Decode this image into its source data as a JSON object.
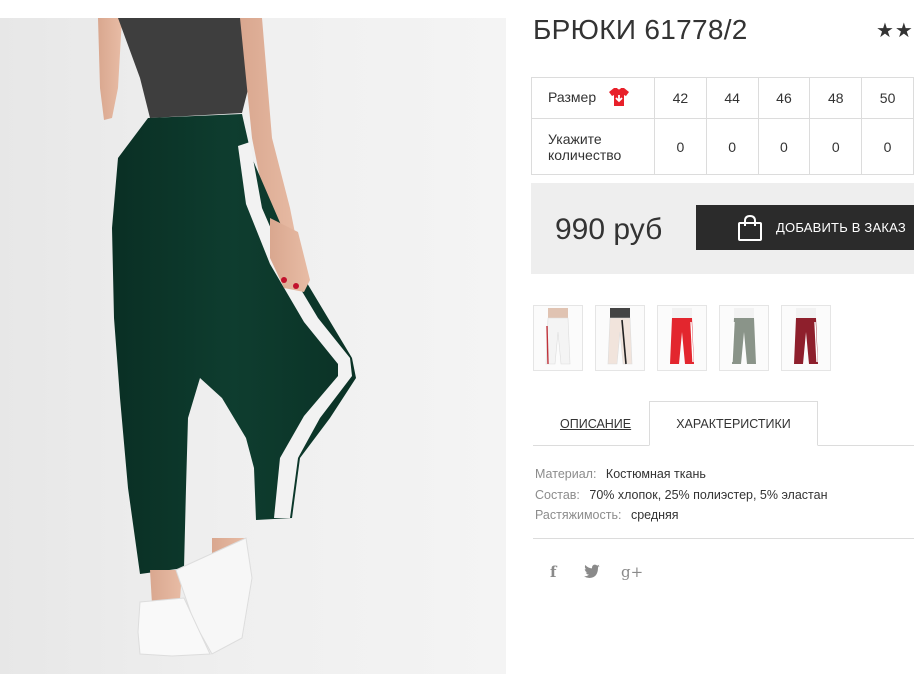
{
  "product": {
    "title": "БРЮКИ 61778/2",
    "rating_stars": "★★★"
  },
  "sizes": {
    "size_label": "Размер",
    "qty_label": "Укажите количество",
    "values": [
      "42",
      "44",
      "46",
      "48",
      "50"
    ],
    "quantities": [
      "0",
      "0",
      "0",
      "0",
      "0"
    ]
  },
  "purchase": {
    "price": "990 руб",
    "add_label": "ДОБАВИТЬ В ЗАКАЗ"
  },
  "thumbnails": [
    {
      "color": "#f4f4f4",
      "stripe": "#c0323a"
    },
    {
      "color": "#f1e4dc",
      "stripe": "#222222"
    },
    {
      "color": "#e3262e",
      "stripe": "#ffffff"
    },
    {
      "color": "#8a9489",
      "stripe": "#ffffff"
    },
    {
      "color": "#8e1f2c",
      "stripe": "#ffffff"
    }
  ],
  "tabs": {
    "description": "ОПИСАНИЕ",
    "characteristics": "ХАРАКТЕРИСТИКИ"
  },
  "specs": [
    {
      "key": "Материал:",
      "value": "Костюмная ткань"
    },
    {
      "key": "Состав:",
      "value": "70% хлопок, 25% полиэстер, 5% эластан"
    },
    {
      "key": "Растяжимость:",
      "value": "средняя"
    }
  ],
  "social": {
    "facebook": "f",
    "twitter": "🐦",
    "google": "g+"
  },
  "colors": {
    "pants_main": "#0d3a2c",
    "button_bg": "#2b2b2b",
    "price_bg": "#eeeeee",
    "tshirt_icon": "#e8202a"
  }
}
